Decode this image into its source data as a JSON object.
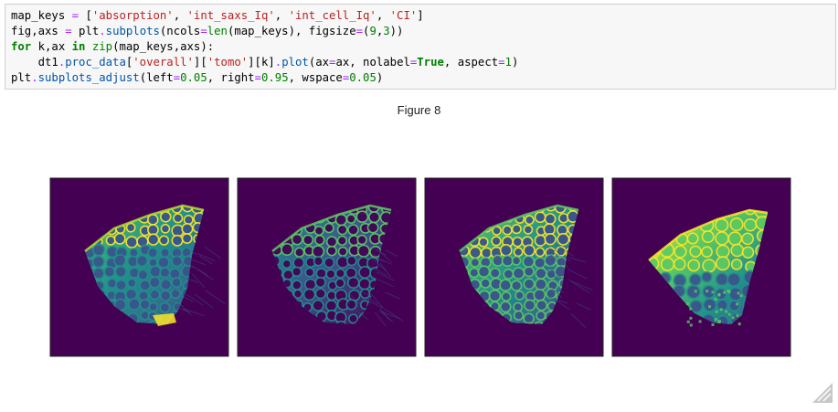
{
  "code_cell": {
    "lines": [
      [
        {
          "t": "map_keys "
        },
        {
          "t": "=",
          "c": "op"
        },
        {
          "t": " ["
        },
        {
          "t": "'absorption'",
          "c": "str"
        },
        {
          "t": ", "
        },
        {
          "t": "'int_saxs_Iq'",
          "c": "str"
        },
        {
          "t": ", "
        },
        {
          "t": "'int_cell_Iq'",
          "c": "str"
        },
        {
          "t": ", "
        },
        {
          "t": "'CI'",
          "c": "str"
        },
        {
          "t": "]"
        }
      ],
      [
        {
          "t": "fig,axs "
        },
        {
          "t": "=",
          "c": "op"
        },
        {
          "t": " plt"
        },
        {
          "t": ".",
          "c": "op"
        },
        {
          "t": "subplots",
          "c": "attr"
        },
        {
          "t": "(ncols"
        },
        {
          "t": "=",
          "c": "op"
        },
        {
          "t": "len",
          "c": "bi"
        },
        {
          "t": "(map_keys), figsize"
        },
        {
          "t": "=",
          "c": "op"
        },
        {
          "t": "("
        },
        {
          "t": "9",
          "c": "num"
        },
        {
          "t": ","
        },
        {
          "t": "3",
          "c": "num"
        },
        {
          "t": "))"
        }
      ],
      [
        {
          "t": "for",
          "c": "kw"
        },
        {
          "t": " k,ax "
        },
        {
          "t": "in",
          "c": "kw"
        },
        {
          "t": " "
        },
        {
          "t": "zip",
          "c": "bi"
        },
        {
          "t": "(map_keys,axs):"
        }
      ],
      [
        {
          "t": "    dt1"
        },
        {
          "t": ".",
          "c": "op"
        },
        {
          "t": "proc_data",
          "c": "attr"
        },
        {
          "t": "["
        },
        {
          "t": "'overall'",
          "c": "str"
        },
        {
          "t": "]["
        },
        {
          "t": "'tomo'",
          "c": "str"
        },
        {
          "t": "][k]"
        },
        {
          "t": ".",
          "c": "op"
        },
        {
          "t": "plot",
          "c": "attr"
        },
        {
          "t": "(ax"
        },
        {
          "t": "=",
          "c": "op"
        },
        {
          "t": "ax, nolabel"
        },
        {
          "t": "=",
          "c": "op"
        },
        {
          "t": "True",
          "c": "kw"
        },
        {
          "t": ", aspect"
        },
        {
          "t": "=",
          "c": "op"
        },
        {
          "t": "1",
          "c": "num"
        },
        {
          "t": ")"
        }
      ],
      [
        {
          "t": "plt"
        },
        {
          "t": ".",
          "c": "op"
        },
        {
          "t": "subplots_adjust",
          "c": "attr"
        },
        {
          "t": "(left"
        },
        {
          "t": "=",
          "c": "op"
        },
        {
          "t": "0.05",
          "c": "num"
        },
        {
          "t": ", right"
        },
        {
          "t": "=",
          "c": "op"
        },
        {
          "t": "0.95",
          "c": "num"
        },
        {
          "t": ", wspace"
        },
        {
          "t": "=",
          "c": "op"
        },
        {
          "t": "0.05",
          "c": "num"
        },
        {
          "t": ")"
        }
      ]
    ]
  },
  "figure": {
    "label": "Figure 8",
    "background_color": "#440154",
    "panels": [
      {
        "key": "absorption",
        "variant": "absorption",
        "edge_glow": "#b5de2b"
      },
      {
        "key": "int_saxs_Iq",
        "variant": "int_saxs_Iq",
        "edge_glow": "#5ec962"
      },
      {
        "key": "int_cell_Iq",
        "variant": "int_cell_Iq",
        "edge_glow": "#5ec962"
      },
      {
        "key": "CI",
        "variant": "CI",
        "edge_glow": "#fde725"
      }
    ],
    "colormap": [
      "#440154",
      "#3b528b",
      "#21918c",
      "#5ec962",
      "#fde725"
    ]
  },
  "icons": {
    "resize_handle": "resize-handle-icon"
  }
}
